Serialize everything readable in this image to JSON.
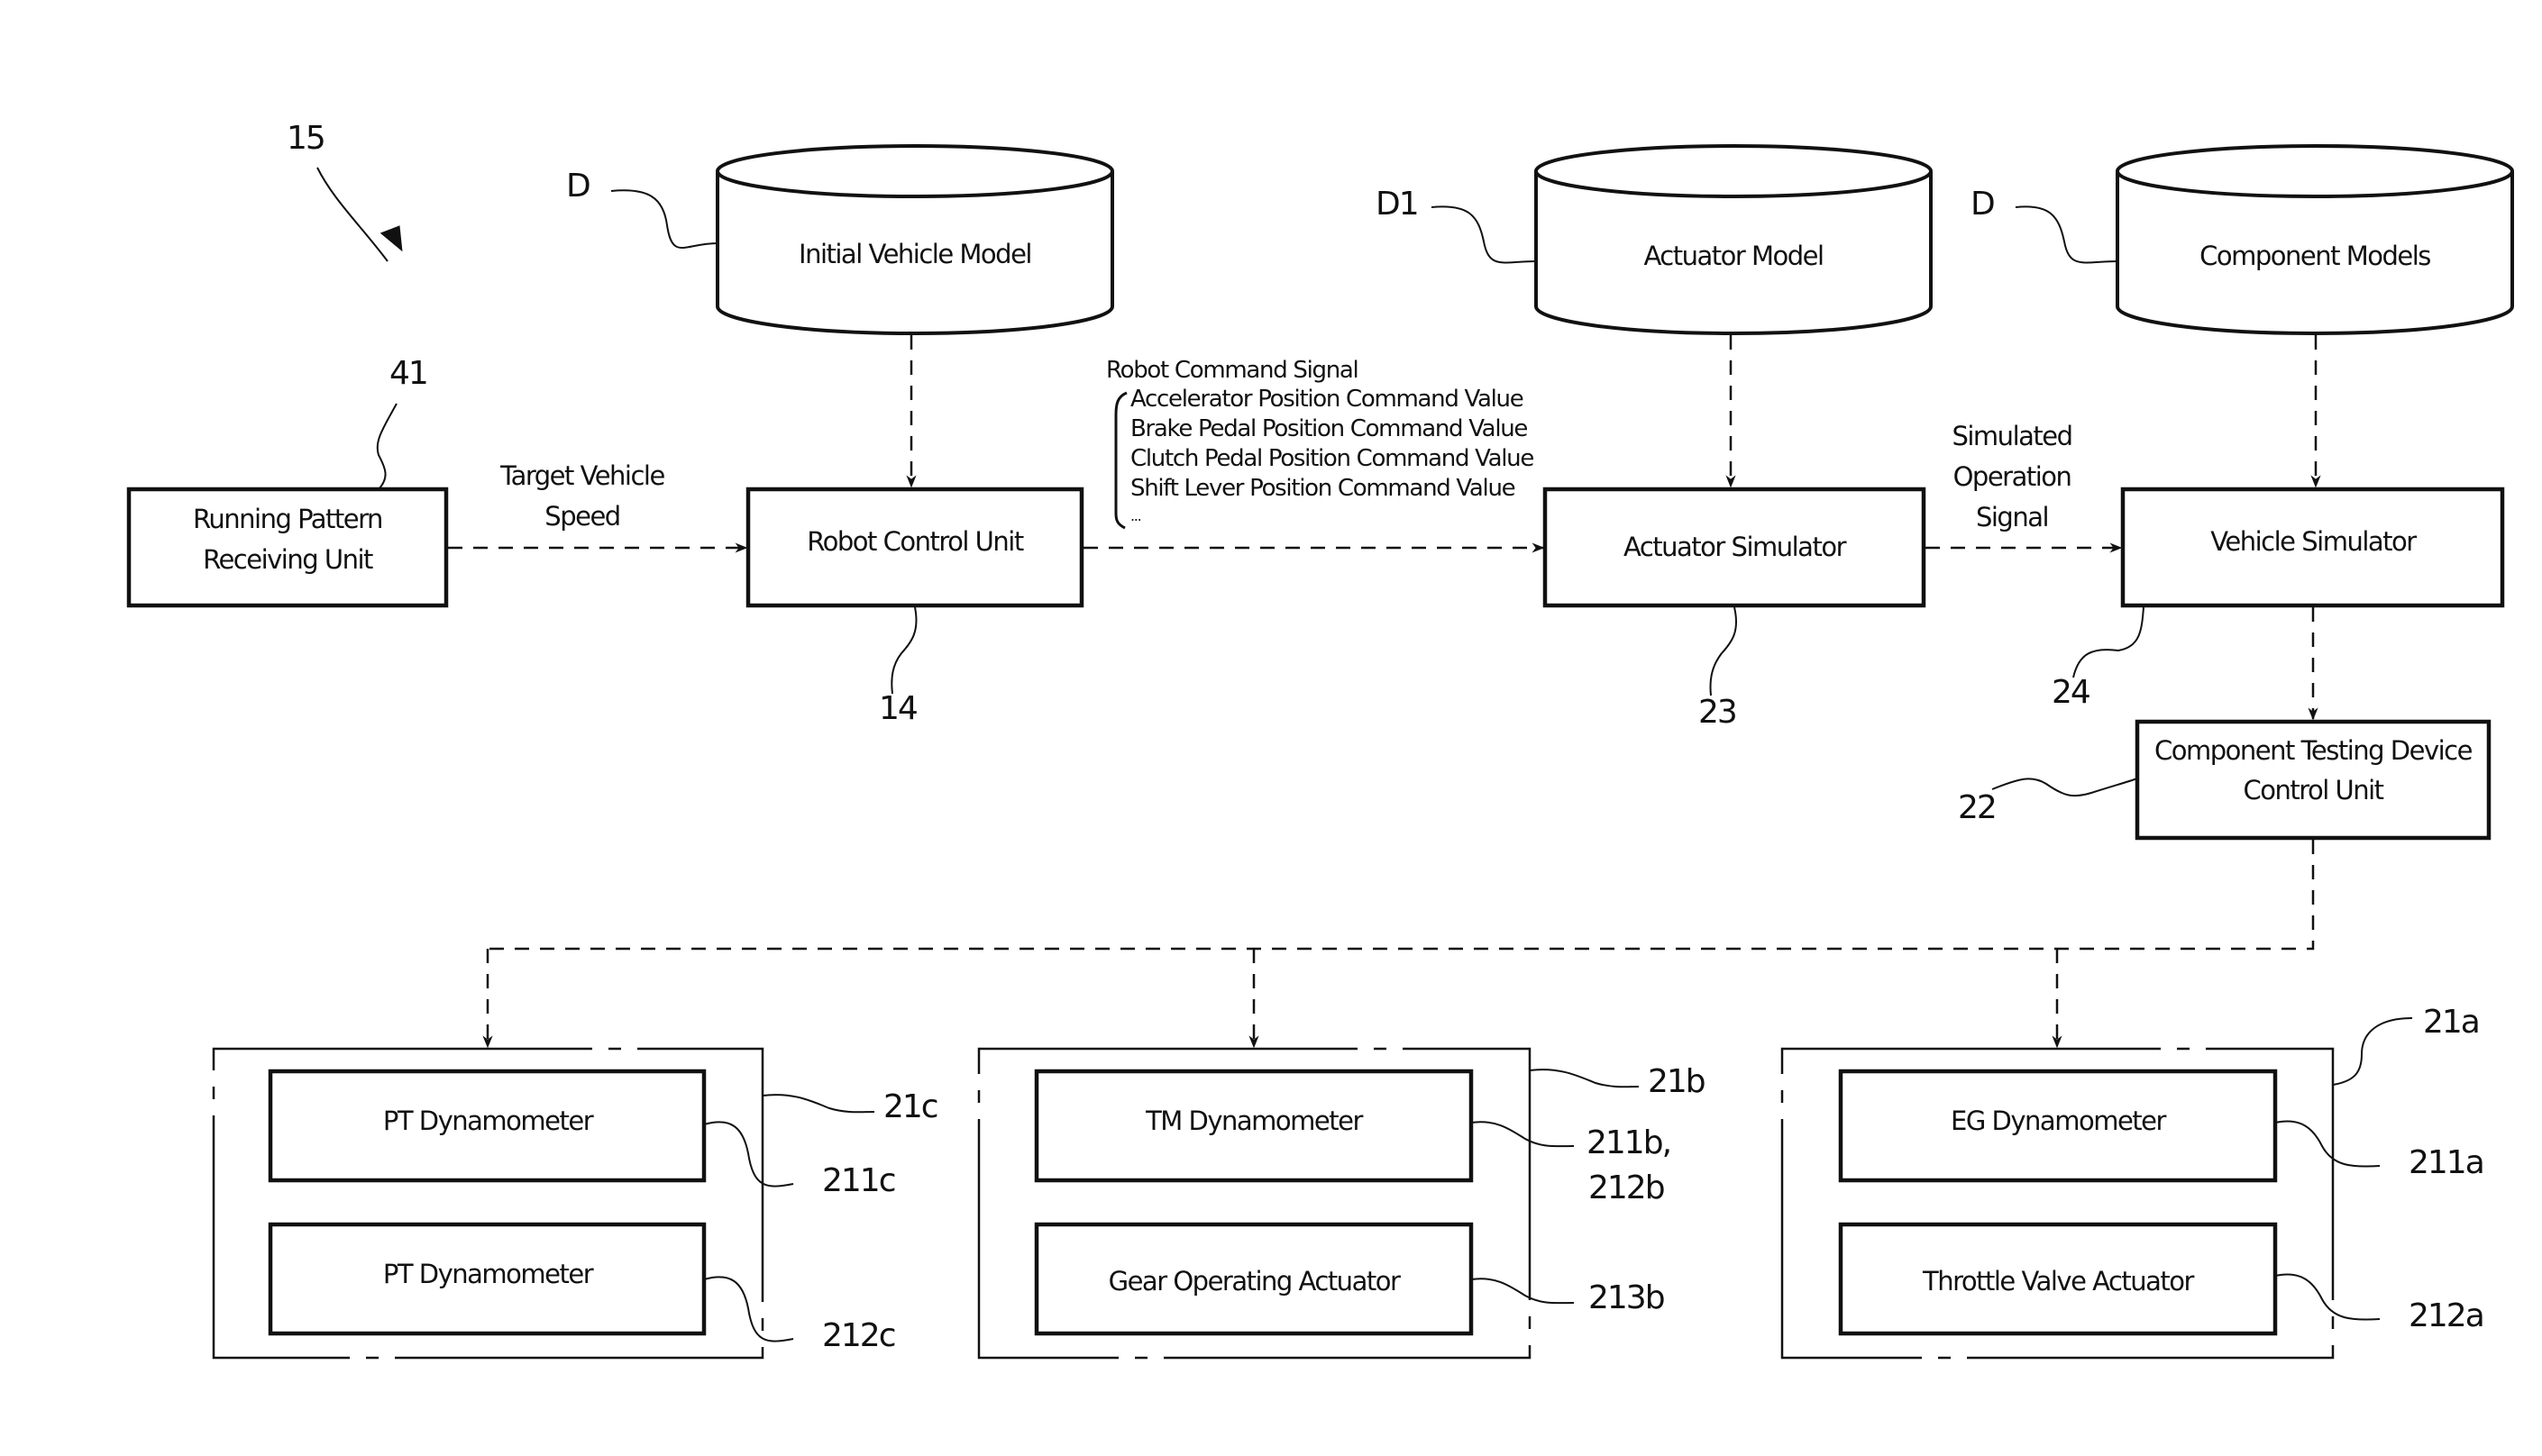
{
  "figure": {
    "reference": "15",
    "databases": [
      {
        "id": "initial-vehicle-model",
        "label": "Initial Vehicle Model",
        "ref": "D"
      },
      {
        "id": "actuator-model",
        "label": "Actuator Model",
        "ref": "D1"
      },
      {
        "id": "component-models",
        "label": "Component Models",
        "ref": "D"
      }
    ],
    "units": {
      "running_pattern": {
        "line1": "Running Pattern",
        "line2": "Receiving Unit",
        "ref": "41"
      },
      "robot_control": {
        "label": "Robot Control Unit",
        "ref": "14"
      },
      "actuator_simulator": {
        "label": "Actuator Simulator",
        "ref": "23"
      },
      "vehicle_simulator": {
        "label": "Vehicle Simulator",
        "ref": "24"
      },
      "ctd_control": {
        "line1": "Component Testing Device",
        "line2": "Control Unit",
        "ref": "22"
      }
    },
    "signals": {
      "target_speed": {
        "line1": "Target Vehicle",
        "line2": "Speed"
      },
      "robot_command": {
        "title": "Robot Command Signal",
        "items": [
          "Accelerator Position Command Value",
          "Brake Pedal Position Command Value",
          "Clutch Pedal Position Command Value",
          "Shift Lever Position Command Value",
          "..."
        ]
      },
      "simulated_operation": {
        "line1": "Simulated",
        "line2": "Operation",
        "line3": "Signal"
      }
    },
    "test_groups": [
      {
        "ref": "21c",
        "components": [
          {
            "label": "PT Dynamometer",
            "ref": "211c"
          },
          {
            "label": "PT Dynamometer",
            "ref": "212c"
          }
        ]
      },
      {
        "ref": "21b",
        "components": [
          {
            "label": "TM Dynamometer",
            "ref": "211b,",
            "ref2": "212b"
          },
          {
            "label": "Gear Operating Actuator",
            "ref": "213b"
          }
        ]
      },
      {
        "ref": "21a",
        "components": [
          {
            "label": "EG Dynamometer",
            "ref": "211a"
          },
          {
            "label": "Throttle Valve Actuator",
            "ref": "212a"
          }
        ]
      }
    ]
  }
}
